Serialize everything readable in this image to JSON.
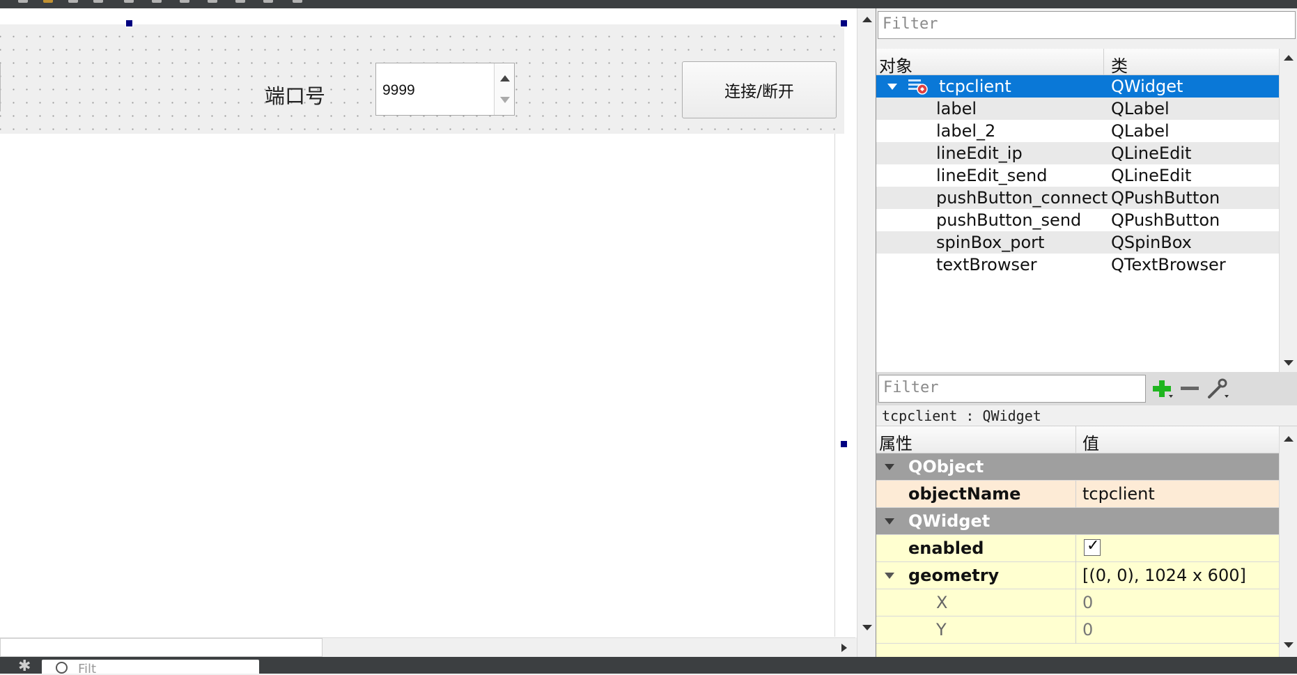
{
  "form": {
    "port_label": "端口号",
    "port_value": "9999",
    "connect_button": "连接/断开"
  },
  "object_inspector": {
    "filter_placeholder": "Filter",
    "columns": {
      "object": "对象",
      "class": "类"
    },
    "root": {
      "name": "tcpclient",
      "class": "QWidget"
    },
    "children": [
      {
        "name": "label",
        "class": "QLabel"
      },
      {
        "name": "label_2",
        "class": "QLabel"
      },
      {
        "name": "lineEdit_ip",
        "class": "QLineEdit"
      },
      {
        "name": "lineEdit_send",
        "class": "QLineEdit"
      },
      {
        "name": "pushButton_connect",
        "class": "QPushButton"
      },
      {
        "name": "pushButton_send",
        "class": "QPushButton"
      },
      {
        "name": "spinBox_port",
        "class": "QSpinBox"
      },
      {
        "name": "textBrowser",
        "class": "QTextBrowser"
      }
    ]
  },
  "property_editor": {
    "filter_placeholder": "Filter",
    "title": "tcpclient : QWidget",
    "columns": {
      "property": "属性",
      "value": "值"
    },
    "groups": [
      {
        "name": "QObject"
      },
      {
        "name": "QWidget"
      }
    ],
    "rows": {
      "objectName": {
        "label": "objectName",
        "value": "tcpclient"
      },
      "enabled": {
        "label": "enabled",
        "checked": true
      },
      "geometry": {
        "label": "geometry",
        "value": "[(0, 0), 1024 x 600]"
      },
      "x": {
        "label": "X",
        "value": "0"
      },
      "y": {
        "label": "Y",
        "value": "0"
      }
    },
    "icons": {
      "add": "plus-icon",
      "remove": "minus-icon",
      "configure": "wrench-icon"
    }
  },
  "bottom": {
    "search_placeholder": "Filt"
  },
  "colors": {
    "selection": "#0a78d7",
    "group_row": "#9f9f9f",
    "highlight_row": "#fdebd6",
    "property_row": "#ffffd0",
    "handle": "#000080"
  }
}
